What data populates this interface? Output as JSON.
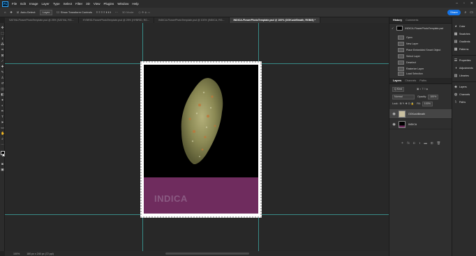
{
  "app": {
    "logo": "Ps"
  },
  "menu": [
    "File",
    "Edit",
    "Image",
    "Layer",
    "Type",
    "Select",
    "Filter",
    "3D",
    "View",
    "Plugins",
    "Window",
    "Help"
  ],
  "window_controls": [
    "–",
    "▫",
    "✕"
  ],
  "options": {
    "auto_select": "Auto-Select:",
    "auto_select_value": "Layer",
    "transform_controls": "Show Transform Controls",
    "mode_3d": "3D Mode:",
    "share": "Share"
  },
  "tabs": [
    {
      "label": "SATIVA-FlowerPhotoTemplate.psd @ 25% (SATIVA, RG...",
      "active": false
    },
    {
      "label": "HYBRID-FlowerPhotoTemplate.psd @ 25% (HYBRID, RG...",
      "active": false
    },
    {
      "label": "INDICA-FlowerPhotoTemplate.psd @ 100% (INDICA, RG...",
      "active": false
    },
    {
      "label": "INDICA-FlowerPhotoTemplate.psd @ 100% (OGKushBmath, RGB/8) *",
      "active": true
    }
  ],
  "canvas": {
    "band_label": "INDICA",
    "band_color": "#6f2c5e"
  },
  "status": {
    "zoom": "100%",
    "size": "180 px x 240 px (72 ppi)"
  },
  "history": {
    "tabs": [
      "History",
      "Comments"
    ],
    "snapshot": "INDICA-FlowerPhotoTemplate.psd",
    "items": [
      "Open",
      "New Layer",
      "Place Embedded Smart Object",
      "Select Layer",
      "Deselect",
      "Rasterize Layer",
      "Load Selection"
    ]
  },
  "layers": {
    "tabs": [
      "Layers",
      "Channels",
      "Paths"
    ],
    "kind": "Q Kind",
    "blend": "Normal",
    "opacity_label": "Opacity:",
    "opacity": "100%",
    "lock_label": "Lock:",
    "fill_label": "Fill:",
    "fill": "100%",
    "list": [
      {
        "name": "OGKushBmath",
        "selected": true
      },
      {
        "name": "INDICA",
        "selected": false
      }
    ]
  },
  "right_panels": {
    "group1": [
      "Color",
      "Swatches",
      "Gradients",
      "Patterns"
    ],
    "group2": [
      "Properties",
      "Adjustments",
      "Libraries"
    ],
    "group3": [
      "Layers",
      "Channels",
      "Paths"
    ]
  }
}
